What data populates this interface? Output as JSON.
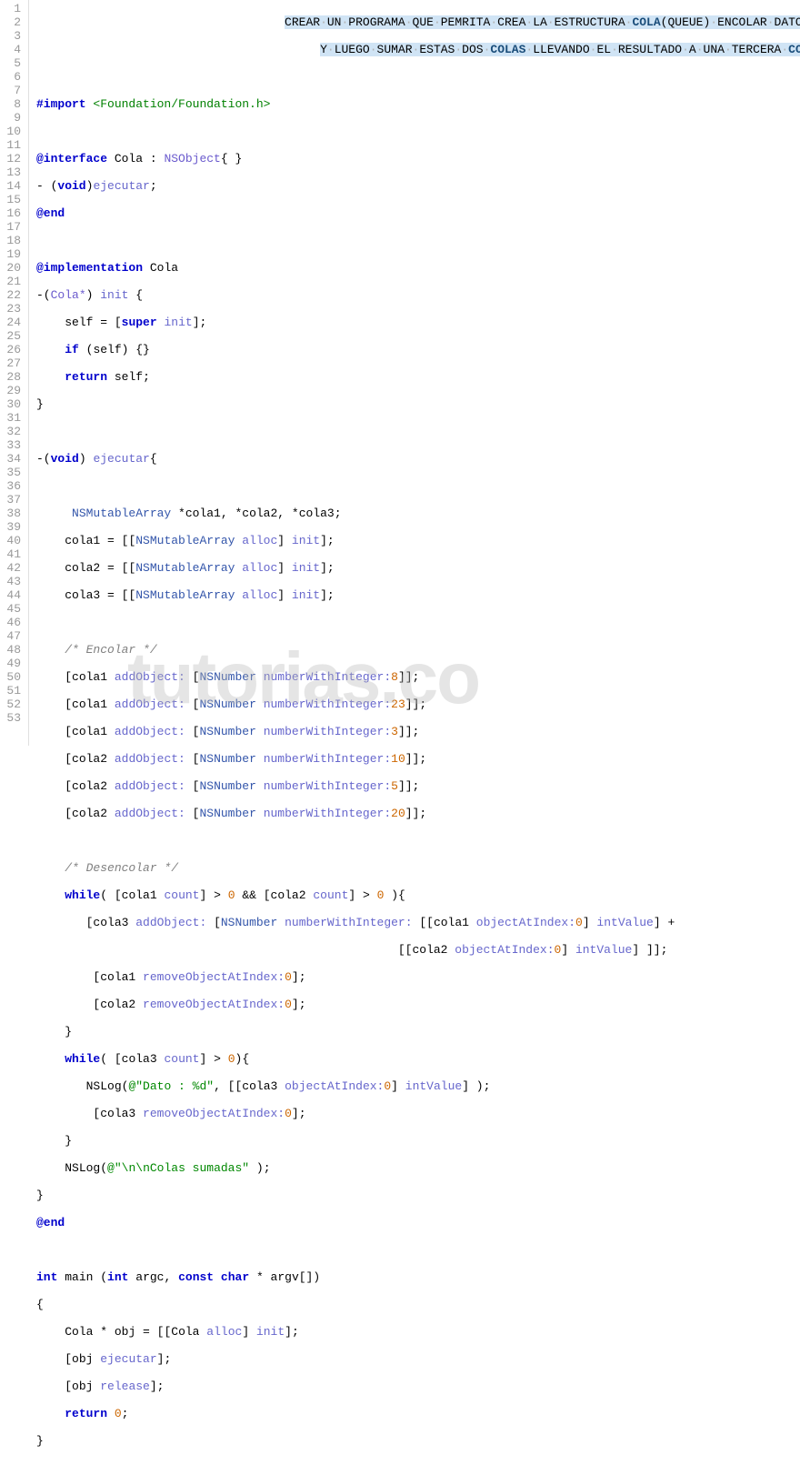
{
  "watermark": "tutorias.co",
  "comment_header": {
    "line1_pre": "CREAR",
    "line1_words": [
      "UN",
      "PROGRAMA",
      "QUE",
      "PEMRITA",
      "CREA",
      "LA",
      "ESTRUCTURA"
    ],
    "cola": "COLA",
    "queue": "(QUEUE)",
    "line1_tail": [
      "ENCOLAR",
      "DATOS"
    ],
    "line2_pre": [
      "Y",
      "LUEGO",
      "SUMAR",
      "ESTAS",
      "DOS"
    ],
    "colas": "COLAS",
    "line2_mid": [
      "LLEVANDO",
      "EL",
      "RESULTADO",
      "A",
      "UNA",
      "TERCERA"
    ],
    "cola2": "COLA"
  },
  "tokens": {
    "import": "#import",
    "foundation": "<Foundation/Foundation.h>",
    "interface": "@interface",
    "cola_cls": "Cola",
    "nsobject": "NSObject",
    "void": "void",
    "ejecutar": "ejecutar",
    "end": "@end",
    "implementation": "@implementation",
    "cola_ptr": "Cola*",
    "init": "init",
    "self": "self",
    "super": "super",
    "if": "if",
    "return": "return",
    "nsmutablearray": "NSMutableArray",
    "cola1": "cola1",
    "cola2": "cola2",
    "cola3": "cola3",
    "alloc": "alloc",
    "encolar_comment": "/* Encolar */",
    "desencolar_comment": "/* Desencolar */",
    "addobject": "addObject:",
    "nsnumber": "NSNumber",
    "numberwithint": "numberWithInteger:",
    "n8": "8",
    "n23": "23",
    "n3": "3",
    "n10": "10",
    "n5": "5",
    "n20": "20",
    "while": "while",
    "count": "count",
    "objectatindex": "objectAtIndex:",
    "zero": "0",
    "intvalue": "intValue",
    "removeobjectatindex": "removeObjectAtIndex:",
    "nslog": "NSLog",
    "str_dato": "\"Dato : %d\"",
    "str_colas": "\"\\n\\nColas sumadas\"",
    "at": "@",
    "int": "int",
    "main": "main",
    "argc": "argc",
    "const": "const",
    "char": "char",
    "argv": "argv[]",
    "obj": "obj",
    "release": "release",
    "zero_ret": "0"
  },
  "line_numbers": [
    "1",
    "2",
    "3",
    "4",
    "5",
    "6",
    "7",
    "8",
    "9",
    "10",
    "11",
    "12",
    "13",
    "14",
    "15",
    "16",
    "17",
    "18",
    "19",
    "20",
    "21",
    "22",
    "23",
    "24",
    "25",
    "26",
    "27",
    "28",
    "29",
    "30",
    "31",
    "32",
    "33",
    "34",
    "35",
    "36",
    "37",
    "38",
    "39",
    "40",
    "41",
    "42",
    "43",
    "44",
    "45",
    "46",
    "47",
    "48",
    "49",
    "50",
    "51",
    "52",
    "53"
  ]
}
